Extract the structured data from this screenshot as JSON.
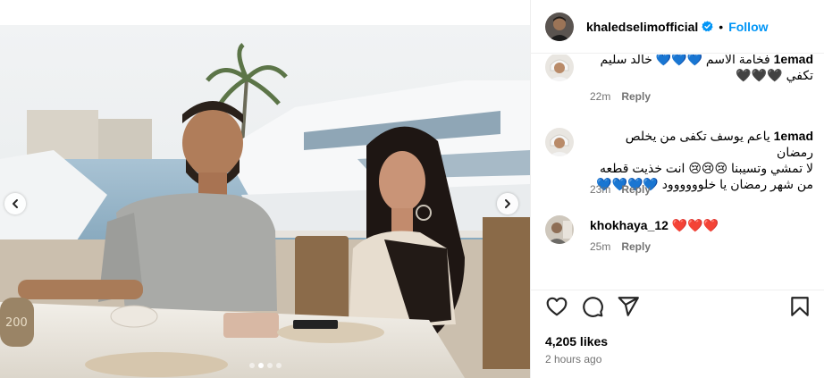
{
  "post": {
    "username": "khaledselimofficial",
    "separator": "•",
    "follow_label": "Follow",
    "likes": "4,205 likes",
    "time_ago": "2 hours ago"
  },
  "comments": [
    {
      "line1_user": "1emad",
      "line1_text": "فخامة الاسم 💙💙💙 خالد سليم",
      "line2": "تكفي 🖤🖤🖤",
      "age": "22m",
      "reply": "Reply"
    },
    {
      "line1_user": "1emad",
      "line1_text": "ياعم يوسف تكفى من يخلص رمضان",
      "line2": "لا تمشي وتسيبنا 😢😢😢 انت خذيت قطعه",
      "line3": "من شهر رمضان يا خلوووووود 💙💙💙💙",
      "age": "23m",
      "reply": "Reply"
    },
    {
      "user": "khokhaya_12",
      "text": "❤️❤️❤️",
      "age": "25m",
      "reply": "Reply"
    }
  ],
  "carousel": {
    "total": 4,
    "active_index": 1
  },
  "colors": {
    "link": "#0095f6",
    "muted": "#737373",
    "verified": "#0095f6"
  }
}
